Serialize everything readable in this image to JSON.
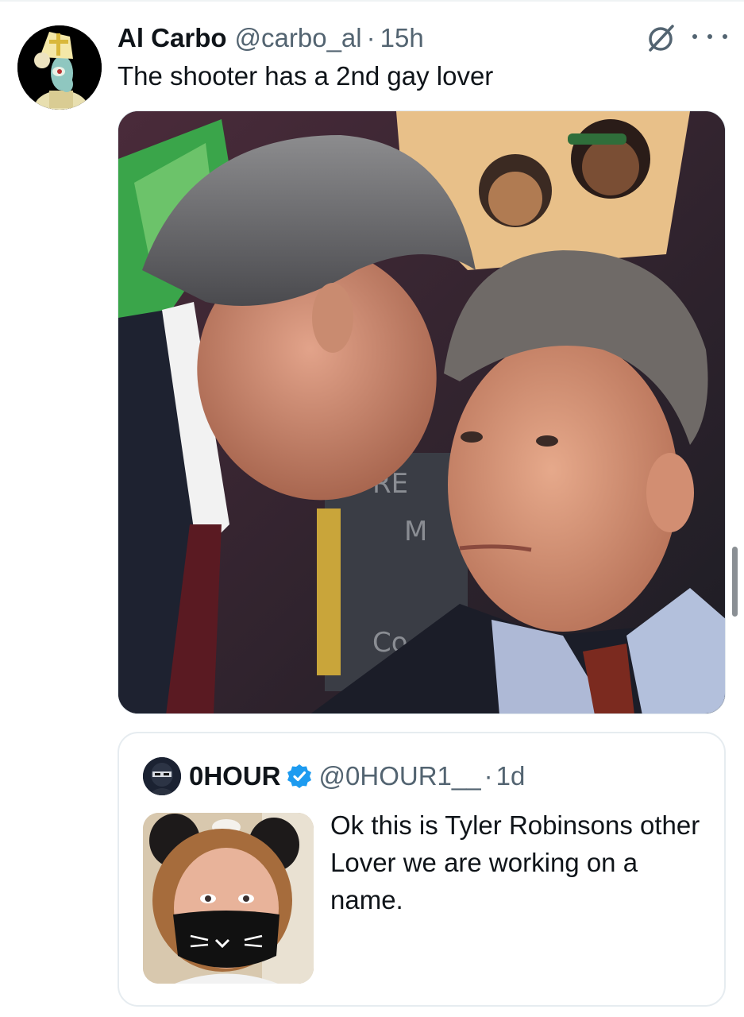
{
  "post": {
    "author_name": "Al Carbo",
    "author_handle": "@carbo_al",
    "separator": "·",
    "time": "15h",
    "text": "The shooter has a 2nd gay lover",
    "avatar_icon": "squidward-pope-avatar",
    "media_description_icon": "photo-two-men-whispering"
  },
  "quote": {
    "author_name": "0HOUR",
    "author_handle": "@0HOUR1__",
    "separator": "·",
    "time": "1d",
    "verified": true,
    "verified_color": "#1d9bf0",
    "text": "Ok this is Tyler Robinsons other Lover we are working on a name.",
    "thumbnail_icon": "photo-person-cat-ears-mask"
  },
  "colors": {
    "text_primary": "#0f1419",
    "text_secondary": "#536471",
    "border": "#e6ecf0"
  }
}
